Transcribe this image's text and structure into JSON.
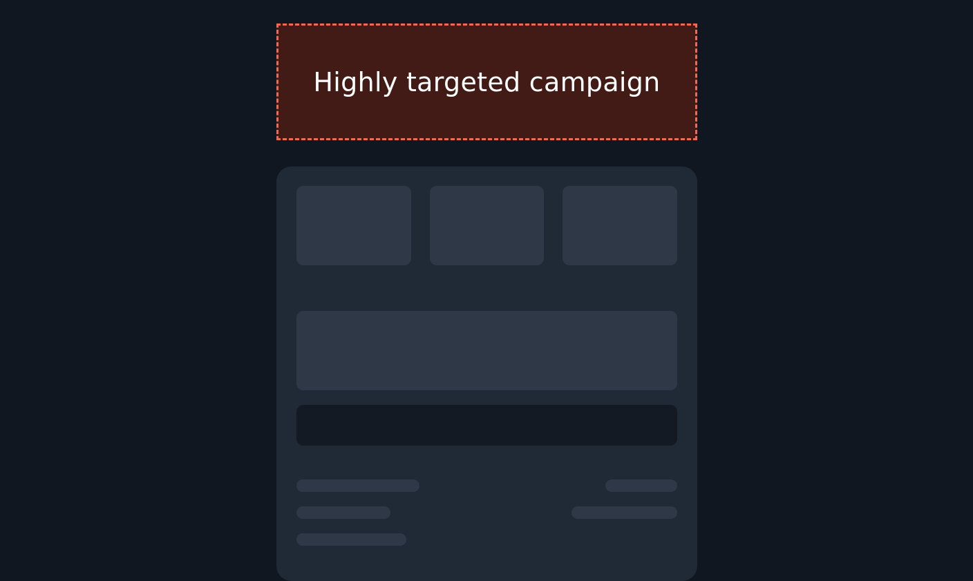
{
  "banner": {
    "text": "Highly targeted campaign",
    "border_color": "#f26a55",
    "background_color": "#421b16"
  },
  "panel": {
    "background_color": "#202a36",
    "state": "loading-skeleton"
  }
}
